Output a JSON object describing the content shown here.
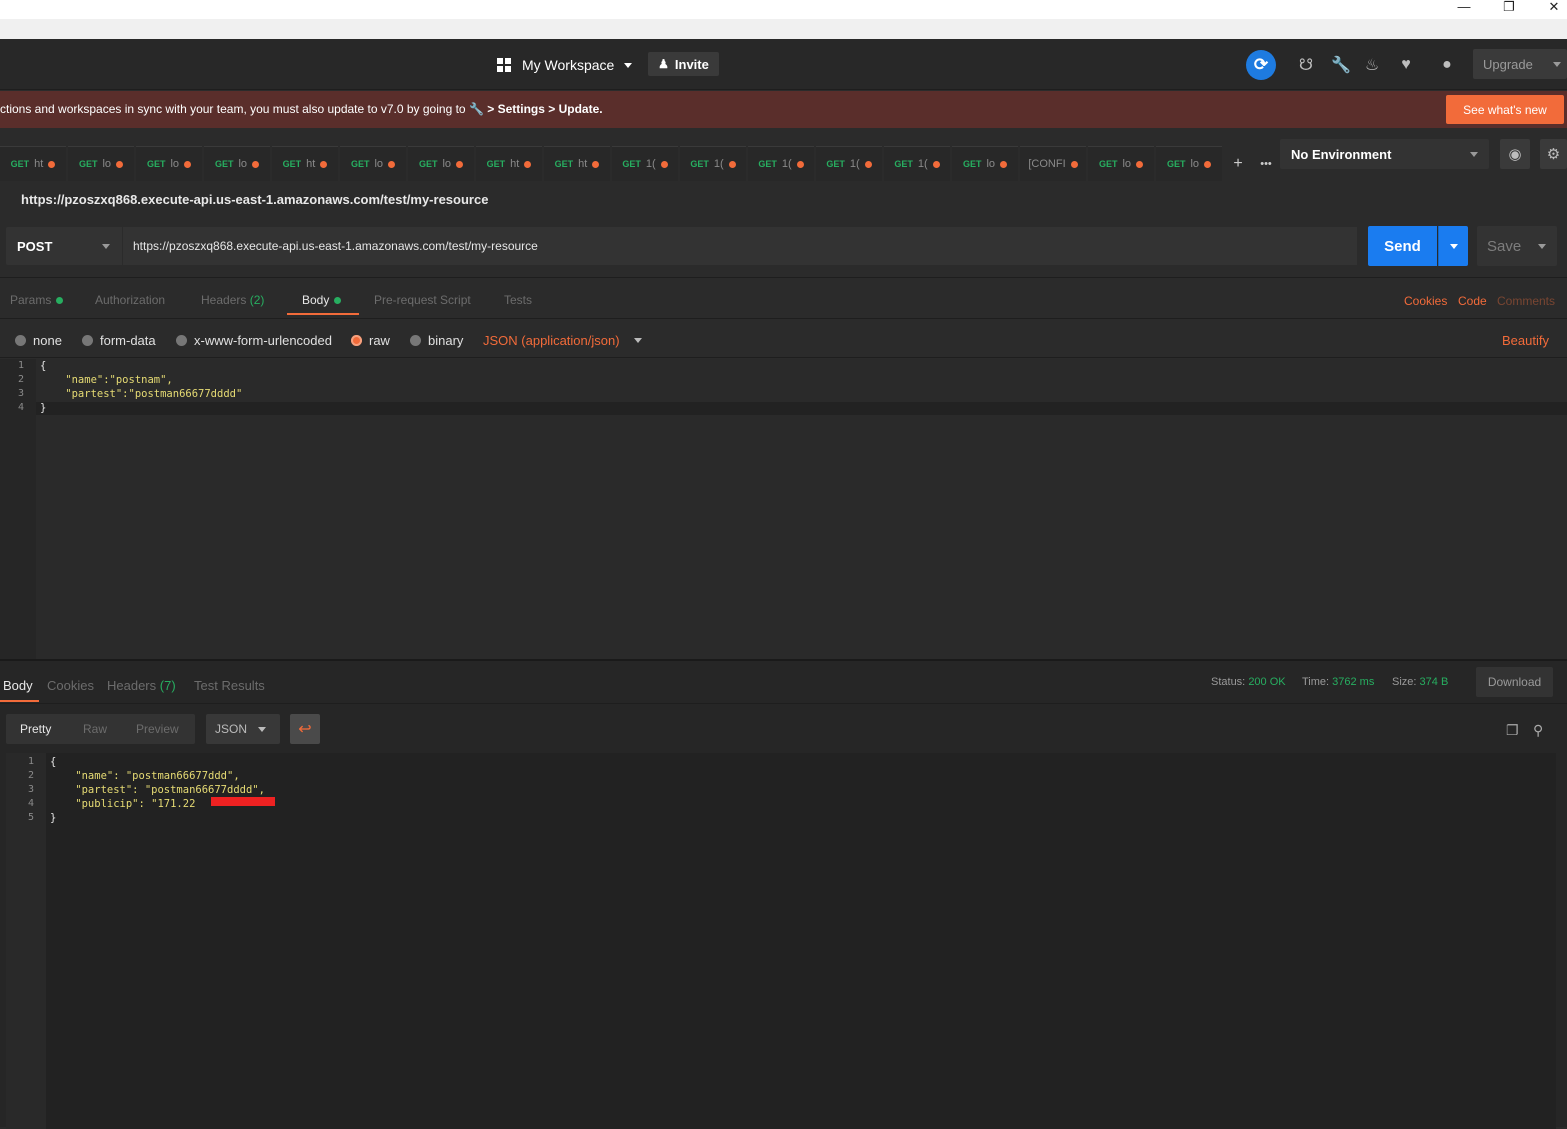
{
  "window": {
    "minimize_glyph": "—",
    "restore_glyph": "❐",
    "close_glyph": "✕"
  },
  "header": {
    "workspace": "My Workspace",
    "invite": "Invite",
    "upgrade": "Upgrade"
  },
  "banner": {
    "message_part1": "ctions and workspaces in sync with your team, you must also update to v7.0 by going to",
    "message_part2": "> Settings > Update.",
    "cta": "See what's new"
  },
  "tabs": [
    {
      "method": "GET",
      "name": "ht"
    },
    {
      "method": "GET",
      "name": "lo"
    },
    {
      "method": "GET",
      "name": "lo"
    },
    {
      "method": "GET",
      "name": "lo"
    },
    {
      "method": "GET",
      "name": "ht"
    },
    {
      "method": "GET",
      "name": "lo"
    },
    {
      "method": "GET",
      "name": "lo"
    },
    {
      "method": "GET",
      "name": "ht"
    },
    {
      "method": "GET",
      "name": "ht"
    },
    {
      "method": "GET",
      "name": "1("
    },
    {
      "method": "GET",
      "name": "1("
    },
    {
      "method": "GET",
      "name": "1("
    },
    {
      "method": "GET",
      "name": "1("
    },
    {
      "method": "GET",
      "name": "1("
    },
    {
      "method": "GET",
      "name": "lo"
    },
    {
      "method": "",
      "name": "[CONFI"
    },
    {
      "method": "GET",
      "name": "lo"
    },
    {
      "method": "GET",
      "name": "lo"
    }
  ],
  "environment": {
    "selected": "No Environment"
  },
  "request": {
    "title": "https://pzoszxq868.execute-api.us-east-1.amazonaws.com/test/my-resource",
    "method": "POST",
    "url": "https://pzoszxq868.execute-api.us-east-1.amazonaws.com/test/my-resource",
    "send": "Send",
    "save": "Save"
  },
  "request_tabs": {
    "params": "Params",
    "authorization": "Authorization",
    "headers": "Headers",
    "headers_count": "(2)",
    "body": "Body",
    "prerequest": "Pre-request Script",
    "tests": "Tests",
    "cookies": "Cookies",
    "code": "Code",
    "comments": "Comments"
  },
  "body_options": {
    "none": "none",
    "form_data": "form-data",
    "urlencoded": "x-www-form-urlencoded",
    "raw": "raw",
    "binary": "binary",
    "content_type": "JSON (application/json)",
    "beautify": "Beautify"
  },
  "request_body": {
    "line_numbers": [
      "1",
      "2",
      "3",
      "4"
    ],
    "lines": [
      "{",
      "    \"name\":\"postnam\",",
      "    \"partest\":\"postman66677dddd\"",
      "}"
    ]
  },
  "response": {
    "tabs": {
      "body": "Body",
      "cookies": "Cookies",
      "headers": "Headers",
      "headers_count": "(7)",
      "test_results": "Test Results"
    },
    "status_label": "Status:",
    "status": "200 OK",
    "time_label": "Time:",
    "time": "3762 ms",
    "size_label": "Size:",
    "size": "374 B",
    "download": "Download",
    "views": {
      "pretty": "Pretty",
      "raw": "Raw",
      "preview": "Preview"
    },
    "format": "JSON",
    "line_numbers": [
      "1",
      "2",
      "3",
      "4",
      "5"
    ],
    "lines": [
      "{",
      "    \"name\": \"postman66677ddd\",",
      "    \"partest\": \"postman66677dddd\",",
      "    \"publicip\": \"171.22",
      "}"
    ]
  },
  "colors": {
    "accent": "#f26b3a",
    "send": "#1a7cf0",
    "success": "#27ae60",
    "banner": "#5a2e2b"
  }
}
